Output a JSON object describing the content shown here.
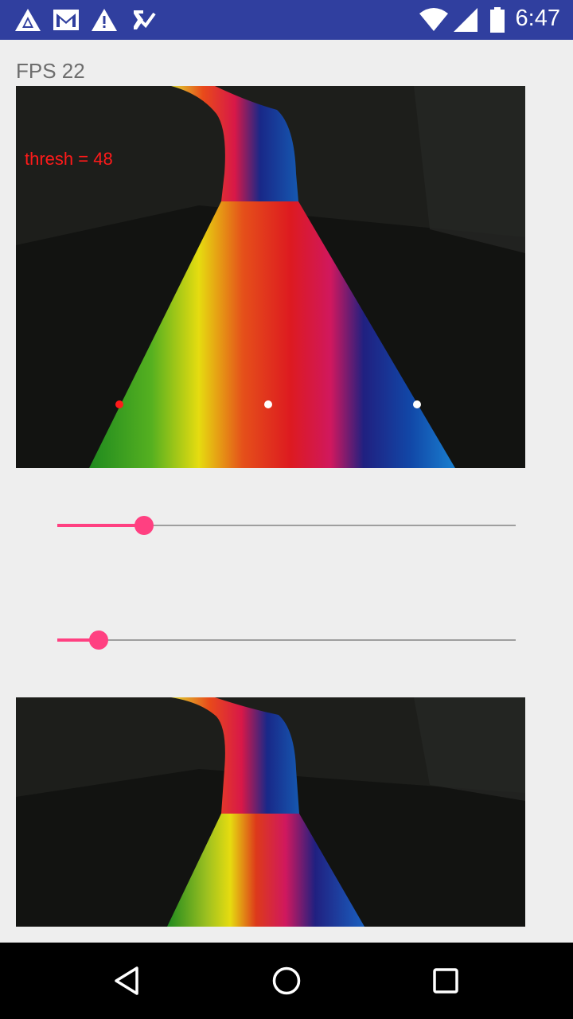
{
  "status_bar": {
    "time": "6:47",
    "left_icons": [
      "app-logo-icon",
      "gmail-icon",
      "warning-icon",
      "check-task-icon"
    ],
    "right_icons": [
      "wifi-icon",
      "cell-signal-icon",
      "battery-icon"
    ]
  },
  "fps_label": "FPS 22",
  "overlay": {
    "thresh_label": "thresh = 48",
    "marker_colors": [
      "#ff1a1a",
      "#ffffff",
      "#ffffff"
    ]
  },
  "sliders": [
    {
      "value_fraction": 0.19
    },
    {
      "value_fraction": 0.09
    }
  ],
  "colors": {
    "accent": "#ff4081",
    "status_bar": "#303f9f"
  },
  "nav_bar": {
    "buttons": [
      "back-icon",
      "home-icon",
      "recents-icon"
    ]
  }
}
